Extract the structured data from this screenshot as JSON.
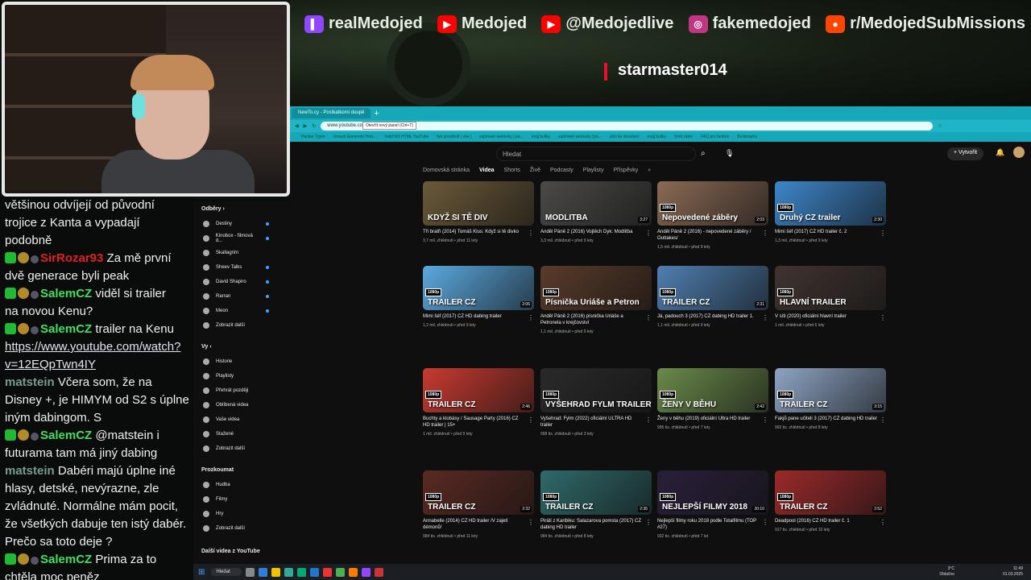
{
  "overlay": {
    "socials": [
      {
        "platform": "twitch",
        "handle": "realMedojed",
        "color": "#9146ff",
        "icon": "twitch-icon"
      },
      {
        "platform": "youtube",
        "handle": "Medojed",
        "color": "#ff0000",
        "icon": "youtube-icon"
      },
      {
        "platform": "youtube",
        "handle": "@Medojedlive",
        "color": "#ff0000",
        "icon": "youtube-icon"
      },
      {
        "platform": "instagram",
        "handle": "fakemedojed",
        "color": "#c13584",
        "icon": "instagram-icon"
      },
      {
        "platform": "reddit",
        "handle": "r/MedojedSubMissions",
        "color": "#ff4500",
        "icon": "reddit-icon"
      }
    ],
    "latest_sub": "starmaster014"
  },
  "browser": {
    "tab_label": "NewTo.cy - Postkatkomi doupě",
    "tooltip": "Otevřít nový panel (Ctrl+T)",
    "url": "www.youtube.com/@TotalfilmCZ/videos",
    "bookmarks": [
      "Hacker Typer",
      "Omezit Elemento Hrát...",
      "Valid W3 HTML YouTube",
      "fan prostředí | vše |",
      "zajímavé webovky | po...",
      "mojj bullky",
      "zajímavé webovky (po...",
      "věci ke zkoušení",
      "mojj bullky",
      "Smrt mám",
      "FAQ pro fanbnk",
      "Bookmarks"
    ]
  },
  "youtube": {
    "search_placeholder": "Hledat",
    "create_label": "+ Vytvořit",
    "channel_tabs": [
      "Domovská stránka",
      "Videa",
      "Shorts",
      "Živě",
      "Podcasty",
      "Playlisty",
      "Příspěvky"
    ],
    "active_tab": "Videa",
    "sidebar": {
      "subs_heading": "Odběry ›",
      "subs": [
        "Destiny",
        "Kinobox - filmová d...",
        "Skallagrim",
        "Sheev Talks",
        "David Shapiro",
        "Rarran",
        "Meon"
      ],
      "show_more": "Zobrazit další",
      "you_heading": "Vy ›",
      "you_items": [
        "Historie",
        "Playlisty",
        "Přehrát později",
        "Oblíbená videa",
        "Vaše videa",
        "Stažené",
        "Zobrazit další"
      ],
      "explore_heading": "Prozkoumat",
      "explore_items": [
        "Hudba",
        "Filmy",
        "Hry",
        "Zobrazit další"
      ],
      "more_heading": "Další videa z YouTube"
    },
    "videos": [
      {
        "thumb_text": "KDYŽ SI TĚ DIV",
        "title": "Tři bratři (2014) Tomáš Klus: Když si tě divko",
        "meta": "3,7 mil. zhlédnutí • před 11 lety",
        "duration": "",
        "color": "#6b5a3a"
      },
      {
        "thumb_text": "MODLITBA",
        "title": "Anděl Páně 2 (2016) Vojtěch Dyk: Modlitba",
        "meta": "3,3 mil. zhlédnutí • před 9 lety",
        "duration": "3:27",
        "color": "#4b4a48"
      },
      {
        "thumb_text": "Nepovedené záběry",
        "title": "Anděl Páně 2 (2016) - nepovedené záběry / Outtakes/",
        "meta": "1,5 mil. zhlédnutí • před 9 lety",
        "duration": "2:03",
        "color": "#8a6a55"
      },
      {
        "thumb_text": "Druhý CZ trailer",
        "title": "Mimi šéf (2017) CZ HD trailer č. 2",
        "meta": "1,3 mil. zhlédnutí • před 9 lety",
        "duration": "2:30",
        "color": "#3d86c9"
      },
      {
        "thumb_text": "TRAILER CZ",
        "title": "Mimi šéf (2017) CZ HD dabing trailer",
        "meta": "1,2 mil. zhlédnutí • před 9 lety",
        "duration": "2:06",
        "color": "#5ba9e0"
      },
      {
        "thumb_text": "Písnička Uriáše a Petron",
        "title": "Anděl Páně 2 (2016) písnička Uriáše a Petronela v krejčovství",
        "meta": "1,1 mil. zhlédnutí • před 9 lety",
        "duration": "",
        "color": "#5a3b2a"
      },
      {
        "thumb_text": "TRAILER CZ",
        "title": "Já, padouch 3 (2017) CZ dabing HD trailer 1.",
        "meta": "1,1 mil. zhlédnutí • před 9 lety",
        "duration": "2:31",
        "color": "#4f7fb0"
      },
      {
        "thumb_text": "HLAVNÍ TRAILER",
        "title": "V síti (2020) oficiální hlavní trailer",
        "meta": "1 mil. zhlédnutí • před 6 lety",
        "duration": "",
        "color": "#403430"
      },
      {
        "thumb_text": "TRAILER CZ",
        "title": "Buchty a klobásy / Sausage Party (2016) CZ HD trailer | 15+",
        "meta": "1 mil. zhlédnutí • před 9 lety",
        "duration": "2:46",
        "color": "#c83a30"
      },
      {
        "thumb_text": "VYŠEHRAD FYLM TRAILER",
        "title": "Vyšehrad: Fylm (2022) oficiální ULTRA HD trailer",
        "meta": "998 tis. zhlédnutí • před 3 lety",
        "duration": "",
        "color": "#2a2a2a"
      },
      {
        "thumb_text": "ŽENY V BĚHU",
        "title": "Ženy v běhu (2019) oficiální Ultra HD trailer",
        "meta": "995 tis. zhlédnutí • před 7 lety",
        "duration": "2:42",
        "color": "#6a8a4a"
      },
      {
        "thumb_text": "TRAILER CZ",
        "title": "Fakjů pane učiteli 3 (2017) CZ dabing HD trailer",
        "meta": "992 tis. zhlédnutí • před 8 lety",
        "duration": "3:15",
        "color": "#8ea4c4"
      },
      {
        "thumb_text": "TRAILER CZ",
        "title": "Annabelle (2014) CZ HD trailer /V zajetí démonů/",
        "meta": "984 tis. zhlédnutí • před 11 lety",
        "duration": "2:32",
        "color": "#5a2a22"
      },
      {
        "thumb_text": "TRAILER CZ",
        "title": "Piráti z Karibiku: Salazarova pomsta (2017) CZ dabing HD trailer",
        "meta": "984 tis. zhlédnutí • před 8 lety",
        "duration": "2:35",
        "color": "#2f6a6a"
      },
      {
        "thumb_text": "NEJLEPŠÍ FILMY 2018",
        "title": "Nejlepší filmy roku 2018 podle Totalfilmu (TOP #27)",
        "meta": "932 tis. zhlédnutí • před 7 let",
        "duration": "20:10",
        "color": "#2a1f3a"
      },
      {
        "thumb_text": "TRAILER CZ",
        "title": "Deadpool (2016) CZ HD trailer č. 1",
        "meta": "917 tis. zhlédnutí • před 10 lety",
        "duration": "2:52",
        "color": "#9a2a2a"
      }
    ]
  },
  "chat": {
    "lines": [
      {
        "text": "většinou odvíjejí od původní"
      },
      {
        "text": "trojice z Kanta a vypadají"
      },
      {
        "text": "podobně"
      },
      {
        "user": "SirRozar93",
        "badge": true,
        "style": "sir",
        "text": "Za mě první"
      },
      {
        "text": "dvě generace byli peak"
      },
      {
        "user": "SalemCZ",
        "badge": true,
        "style": "salem",
        "text": "viděl si trailer"
      },
      {
        "text": "na novou Kenu?"
      },
      {
        "user": "SalemCZ",
        "badge": true,
        "style": "salem",
        "text": "trailer na Kenu"
      },
      {
        "link": "https://www.youtube.com/watch?"
      },
      {
        "link": "v=12EQpTwn4IY"
      },
      {
        "user": "matstein",
        "style": "mat",
        "text": "Včera som, že na"
      },
      {
        "text": "Disney +, je HIMYM od S2 s úplne"
      },
      {
        "text": "iným dabingom. S"
      },
      {
        "user": "SalemCZ",
        "badge": true,
        "style": "salem",
        "text": "@matstein i"
      },
      {
        "text": "futurama tam má jiný dabing"
      },
      {
        "user": "matstein",
        "style": "mat",
        "text": "Dabéri majú úplne iné"
      },
      {
        "text": "hlasy, detské, nevýrazne, zle"
      },
      {
        "text": "zvládnuté. Normálne mám pocit,"
      },
      {
        "text": "že všetkých dabuje ten istý dabér."
      },
      {
        "text": "Prečo sa toto deje ?"
      },
      {
        "user": "SalemCZ",
        "badge": true,
        "style": "salem",
        "text": "Prima za to"
      },
      {
        "text": "chtěla moc peněz"
      }
    ]
  },
  "taskbar": {
    "search_label": "Hledat",
    "weather": "3°C",
    "weather_note": "Oblačno",
    "time": "11:49",
    "date": "01.03.2025"
  }
}
